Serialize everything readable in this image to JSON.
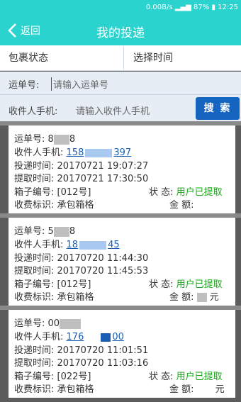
{
  "statusbar": {
    "speed": "0.00B/s",
    "battery": "87%",
    "time": "12:25"
  },
  "header": {
    "back_label": "返回",
    "title": "我的投递"
  },
  "filters": {
    "package_status": "包裹状态",
    "select_time": "选择时间"
  },
  "search": {
    "waybill_label": "运单号:",
    "waybill_placeholder": "请输入运单号",
    "phone_label": "收件人手机:",
    "phone_placeholder": "请输入收件人手机",
    "button_label": "搜 索"
  },
  "labels": {
    "waybill": "运单号:",
    "phone": "收件人手机:",
    "deliver_time": "投递时间:",
    "pickup_time": "提取时间:",
    "box": "箱子编号:",
    "status": "状 态:",
    "fee_tag": "收费标识:",
    "amount": "金 额:"
  },
  "records": [
    {
      "waybill_a": "8",
      "waybill_b": "8",
      "phone_a": "158",
      "phone_b": "397",
      "deliver_time": "20170721 19:07:27",
      "pickup_time": "20170721 17:30:50",
      "box": "[012号]",
      "status": "用户已提取",
      "fee": "承包箱格",
      "amount": ""
    },
    {
      "waybill_a": "5",
      "waybill_b": "8",
      "phone_a": "18",
      "phone_b": "45",
      "deliver_time": "20170720 11:44:30",
      "pickup_time": "20170720 11:45:53",
      "box": "[012号]",
      "status": "用户已提取",
      "fee": "承包箱格",
      "amount": "元"
    },
    {
      "waybill_a": "00",
      "waybill_b": "",
      "phone_a": "176",
      "phone_b": "00",
      "deliver_time": "20170720 11:01:51",
      "pickup_time": "20170720 11:03:16",
      "box": "[022号]",
      "status": "用户已提取",
      "fee": "承包箱格",
      "amount": "元"
    }
  ]
}
